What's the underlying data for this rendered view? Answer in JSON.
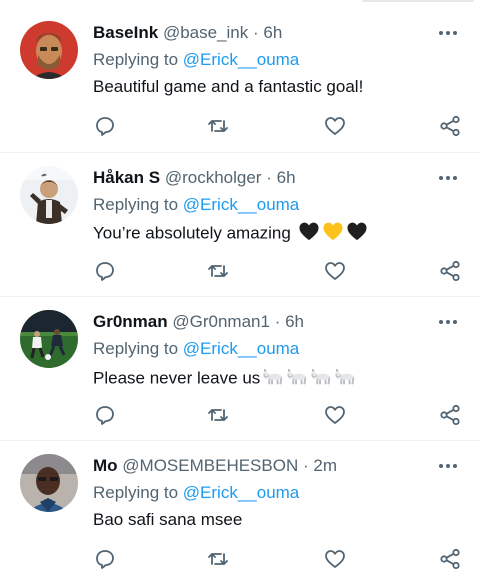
{
  "tweets": [
    {
      "name": "BaseInk",
      "handle": "@base_ink",
      "time": "6h",
      "replying_label": "Replying to",
      "replying_to": "@Erick__ouma",
      "text": "Beautiful game and a fantastic goal!"
    },
    {
      "name": "Håkan S",
      "handle": "@rockholger",
      "time": "6h",
      "replying_label": "Replying to",
      "replying_to": "@Erick__ouma",
      "text": "You’re absolutely amazing",
      "emojis": [
        "black-heart-emoji",
        "yellow-heart-emoji",
        "black-heart-emoji"
      ]
    },
    {
      "name": "Gr0nman",
      "handle": "@Gr0nman1",
      "time": "6h",
      "replying_label": "Replying to",
      "replying_to": "@Erick__ouma",
      "text": "Please never leave us",
      "emojis": [
        "goat-emoji",
        "goat-emoji",
        "goat-emoji",
        "goat-emoji"
      ]
    },
    {
      "name": "Mo",
      "handle": "@MOSEMBEHESBON",
      "time": "2m",
      "replying_label": "Replying to",
      "replying_to": "@Erick__ouma",
      "text": "Bao safi sana msee"
    }
  ],
  "separator": "·",
  "icons": [
    "more-icon",
    "reply-icon",
    "retweet-icon",
    "like-icon",
    "share-icon"
  ],
  "colors": {
    "text": "#0f1419",
    "secondary": "#536471",
    "link": "#1d9bf0",
    "divider": "#eff3f4"
  }
}
